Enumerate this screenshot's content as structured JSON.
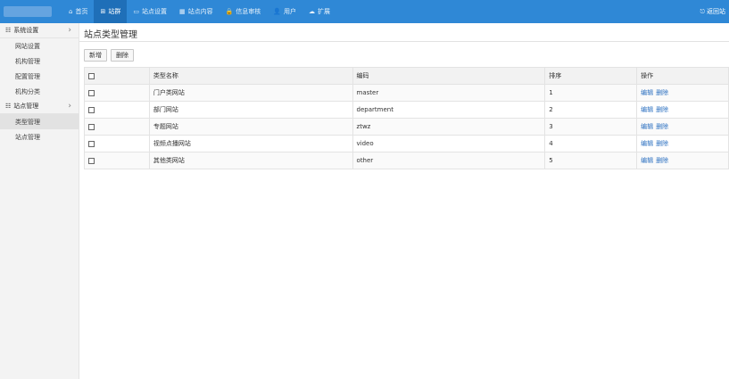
{
  "nav": {
    "items": [
      {
        "icon": "home-icon",
        "glyph": "⌂",
        "label": "首页",
        "active": false
      },
      {
        "icon": "windows-icon",
        "glyph": "⊞",
        "label": "站群",
        "active": true
      },
      {
        "icon": "monitor-icon",
        "glyph": "▭",
        "label": "站点设置",
        "active": false
      },
      {
        "icon": "table-icon",
        "glyph": "▦",
        "label": "站点内容",
        "active": false
      },
      {
        "icon": "lock-icon",
        "glyph": "🔒",
        "label": "信息审核",
        "active": false
      },
      {
        "icon": "user-icon",
        "glyph": "👤",
        "label": "用户",
        "active": false
      },
      {
        "icon": "cloud-icon",
        "glyph": "☁",
        "label": "扩展",
        "active": false
      }
    ],
    "right_label": "返回站"
  },
  "sidebar": {
    "groups": [
      {
        "title": "系统设置",
        "items": [
          "网站设置",
          "机构管理",
          "配置管理",
          "机构分类"
        ]
      },
      {
        "title": "站点管理",
        "items": [
          "类型管理",
          "站点管理"
        ]
      }
    ]
  },
  "main": {
    "title": "站点类型管理",
    "add_label": "新增",
    "delete_label": "删除",
    "columns": [
      "",
      "类型名称",
      "编码",
      "排序",
      "操作"
    ],
    "rows": [
      {
        "name": "门户类网站",
        "code": "master",
        "sort": "1"
      },
      {
        "name": "部门网站",
        "code": "department",
        "sort": "2"
      },
      {
        "name": "专题网站",
        "code": "ztwz",
        "sort": "3"
      },
      {
        "name": "视频点播网站",
        "code": "video",
        "sort": "4"
      },
      {
        "name": "其他类网站",
        "code": "other",
        "sort": "5"
      }
    ],
    "edit_label": "编辑",
    "remove_label": "删除"
  },
  "colors": {
    "topbar": "#2f88d6",
    "topbar_active": "#1f6fb8",
    "link": "#2a6fc0"
  }
}
